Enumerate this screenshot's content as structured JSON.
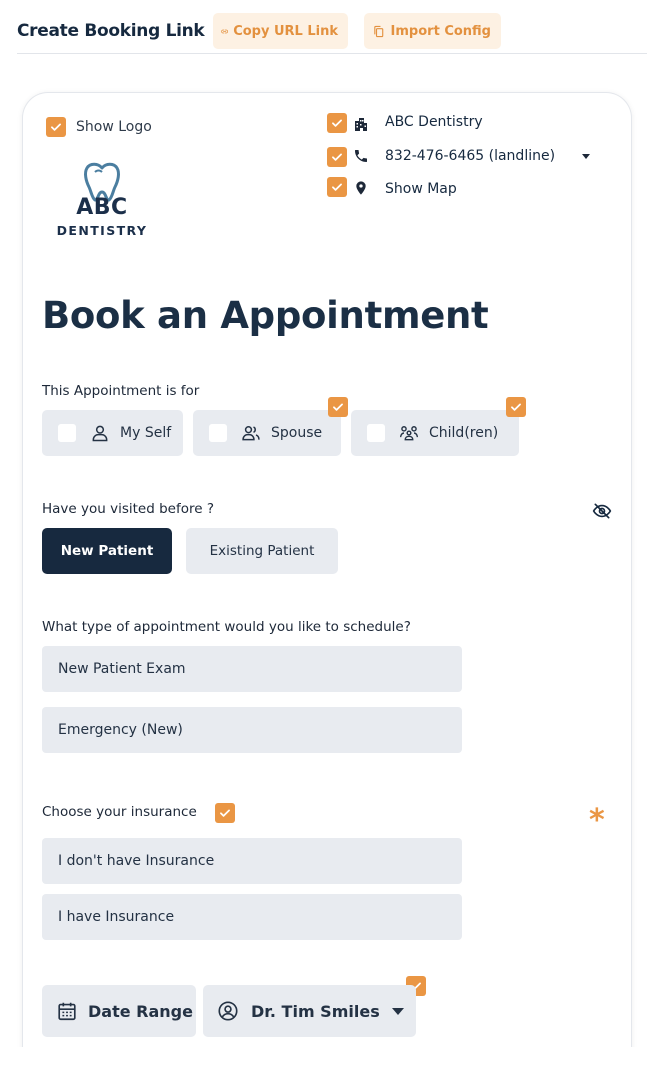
{
  "header": {
    "title": "Create Booking Link",
    "copy_label": "Copy URL Link",
    "import_label": "Import Config"
  },
  "branding": {
    "show_logo_label": "Show Logo",
    "logo_line1": "ABC",
    "logo_line2": "DENTISTRY",
    "practice_name": "ABC Dentistry",
    "phone": "832-476-6465 (landline)",
    "show_map_label": "Show Map"
  },
  "page": {
    "heading": "Book an Appointment"
  },
  "appointment_for": {
    "label": "This Appointment is for",
    "options": [
      "My Self",
      "Spouse",
      "Child(ren)"
    ]
  },
  "visited": {
    "label": "Have you visited before ?",
    "new_label": "New Patient",
    "existing_label": "Existing Patient",
    "selected": "New Patient"
  },
  "appointment_type": {
    "label": "What type of appointment would you like to schedule?",
    "options": [
      "New Patient Exam",
      "Emergency (New)"
    ]
  },
  "insurance": {
    "label": "Choose your insurance",
    "required_mark": "*",
    "options": [
      "I don't have Insurance",
      "I have Insurance"
    ]
  },
  "footer_controls": {
    "date_range_label": "Date Range",
    "doctor_label": "Dr. Tim Smiles"
  },
  "colors": {
    "accent": "#ea9644",
    "navy": "#17293f",
    "chip_bg": "#e8ebf0"
  }
}
